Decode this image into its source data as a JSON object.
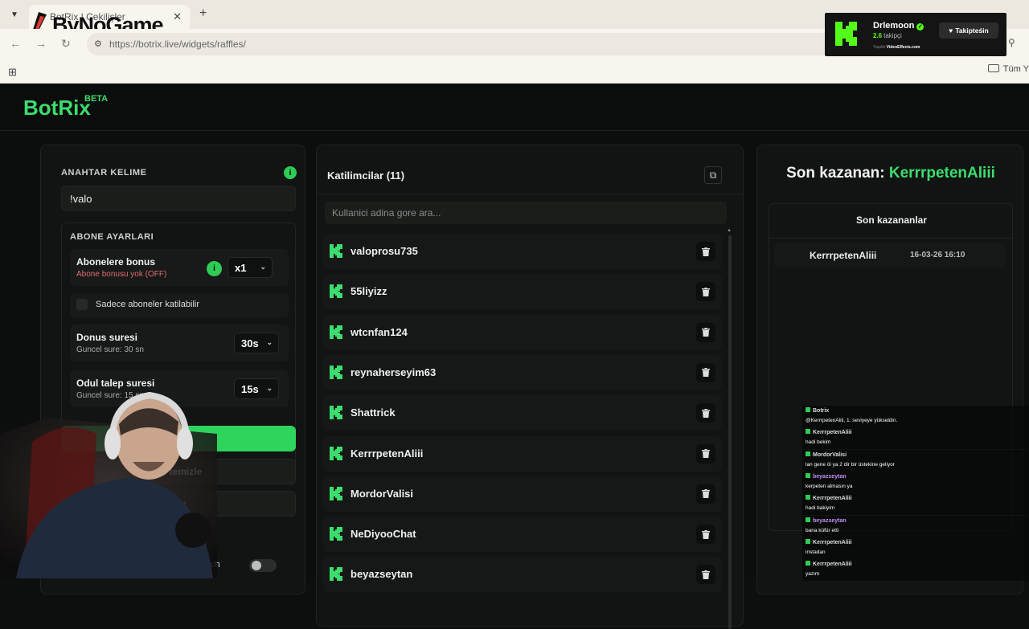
{
  "browser": {
    "tab_title": "BotRix | Çekilişler",
    "url": "https://botrix.live/widgets/raffles/",
    "bookmark_folder": "Tüm Y",
    "watermark": "ByNoGame"
  },
  "follow_overlay": {
    "name": "Drlemoon",
    "followers_count": "2.6",
    "followers_label": "takipçi",
    "made_by_label": "Yapıldı",
    "made_by_brand": "VideoEffects.com",
    "button": "Takipteśin"
  },
  "brand": {
    "name": "BotRix",
    "badge": "BETA"
  },
  "left": {
    "keyword_label": "ANAHTAR KELIME",
    "keyword_value": "!valo",
    "sub_settings_label": "ABONE AYARLARI",
    "sub_bonus_title": "Abonelere bonus",
    "sub_bonus_sub": "Abone bonusu yok (OFF)",
    "sub_bonus_value": "x1",
    "sub_only_label": "Sadece aboneler katilabilir",
    "duration_title": "Donus suresi",
    "duration_sub": "Guncel sure: 30 sn",
    "duration_value": "30s",
    "claim_title": "Odul talep suresi",
    "claim_sub": "Guncel sure: 15 sn",
    "claim_value": "15s",
    "start_button": "slat",
    "clear_button_1": "ari temizle",
    "clear_button_2": "izle",
    "toggle_label": "ch"
  },
  "participants": {
    "title": "Katilimcilar (11)",
    "search_placeholder": "Kullanici adina gore ara...",
    "list": [
      "valoprosu735",
      "55liyizz",
      "wtcnfan124",
      "reynaherseyim63",
      "Shattrick",
      "KerrrpetenAliii",
      "MordorValisi",
      "NeDiyooChat",
      "beyazseytan"
    ]
  },
  "winner": {
    "label": "Son kazanan:",
    "name": "KerrrpetenAliii",
    "list_title": "Son kazananlar",
    "rows": [
      {
        "name": "KerrrpetenAliii",
        "date": "16-03-26 16:10"
      }
    ]
  },
  "chat": [
    {
      "user": "Botrix",
      "msg": "@KerrrpetenAliii, 1. seviyeye yükseldin.",
      "color": "#dddddd"
    },
    {
      "user": "KerrrpetenAliii",
      "msg": "hadi bekim",
      "color": "#dddddd"
    },
    {
      "user": "MordorValisi",
      "msg": "lan gene öi ya 2 dir bir üstekine geliyor",
      "color": "#dddddd"
    },
    {
      "user": "beyazseytan",
      "msg": "kerpeten almasın ya",
      "color": "#c58cf5"
    },
    {
      "user": "KerrrpetenAliii",
      "msg": "hadi bakiyim",
      "color": "#dddddd"
    },
    {
      "user": "beyazseytan",
      "msg": "bana küfür etti",
      "color": "#c58cf5"
    },
    {
      "user": "KerrrpetenAliii",
      "msg": "instadan",
      "color": "#dddddd"
    },
    {
      "user": "KerrrpetenAliii",
      "msg": "yazım",
      "color": "#dddddd"
    }
  ],
  "colors": {
    "accent": "#2fd45d",
    "kick_green": "#53fc18",
    "background": "#0b0e0c"
  }
}
